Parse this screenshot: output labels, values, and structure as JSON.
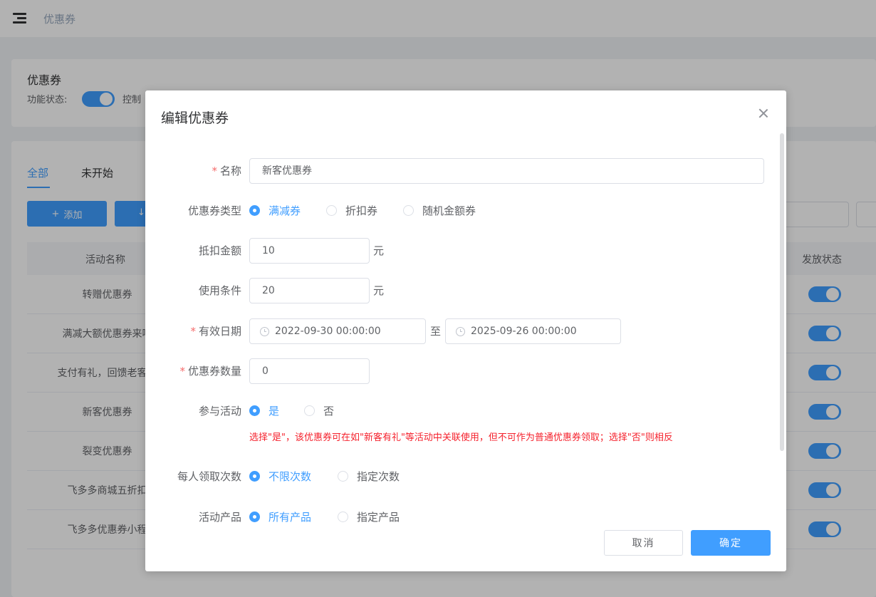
{
  "topbar": {
    "breadcrumb": "优惠券"
  },
  "card1": {
    "title": "优惠券",
    "status_label": "功能状态:",
    "control_label": "控制"
  },
  "tabs": [
    "全部",
    "未开始"
  ],
  "toolbar": {
    "add_label": "添加",
    "add_icon": "+"
  },
  "table": {
    "col_name": "活动名称",
    "col_status": "发放状态",
    "rows": [
      "转赠优惠券",
      "满减大额优惠券来啦",
      "支付有礼，回馈老客户",
      "新客优惠券",
      "裂变优惠券",
      "飞多多商城五折扣",
      "飞多多优惠券小程"
    ]
  },
  "dialog": {
    "title": "编辑优惠券",
    "name": {
      "label": "名称",
      "value": "新客优惠券"
    },
    "type": {
      "label": "优惠券类型",
      "options": [
        "满减券",
        "折扣券",
        "随机金额券"
      ],
      "selected": 0
    },
    "discount": {
      "label": "抵扣金额",
      "value": "10",
      "unit": "元"
    },
    "condition": {
      "label": "使用条件",
      "value": "20",
      "unit": "元"
    },
    "validity": {
      "label": "有效日期",
      "start": "2022-09-30 00:00:00",
      "separator": "至",
      "end": "2025-09-26 00:00:00"
    },
    "quantity": {
      "label": "优惠券数量",
      "value": "0"
    },
    "join": {
      "label": "参与活动",
      "yes": "是",
      "no": "否",
      "selected": "yes"
    },
    "hint": "选择\"是\"，该优惠券可在如\"新客有礼\"等活动中关联使用，但不可作为普通优惠券领取；选择\"否\"则相反",
    "claim": {
      "label": "每人领取次数",
      "unlimited": "不限次数",
      "specified": "指定次数",
      "selected": "unlimited"
    },
    "product": {
      "label": "活动产品",
      "all": "所有产品",
      "specified": "指定产品",
      "selected": "all"
    },
    "cancel_label": "取消",
    "ok_label": "确定"
  },
  "colors": {
    "primary": "#409eff",
    "danger": "#f56c6c",
    "hint_red": "#f5222d"
  }
}
